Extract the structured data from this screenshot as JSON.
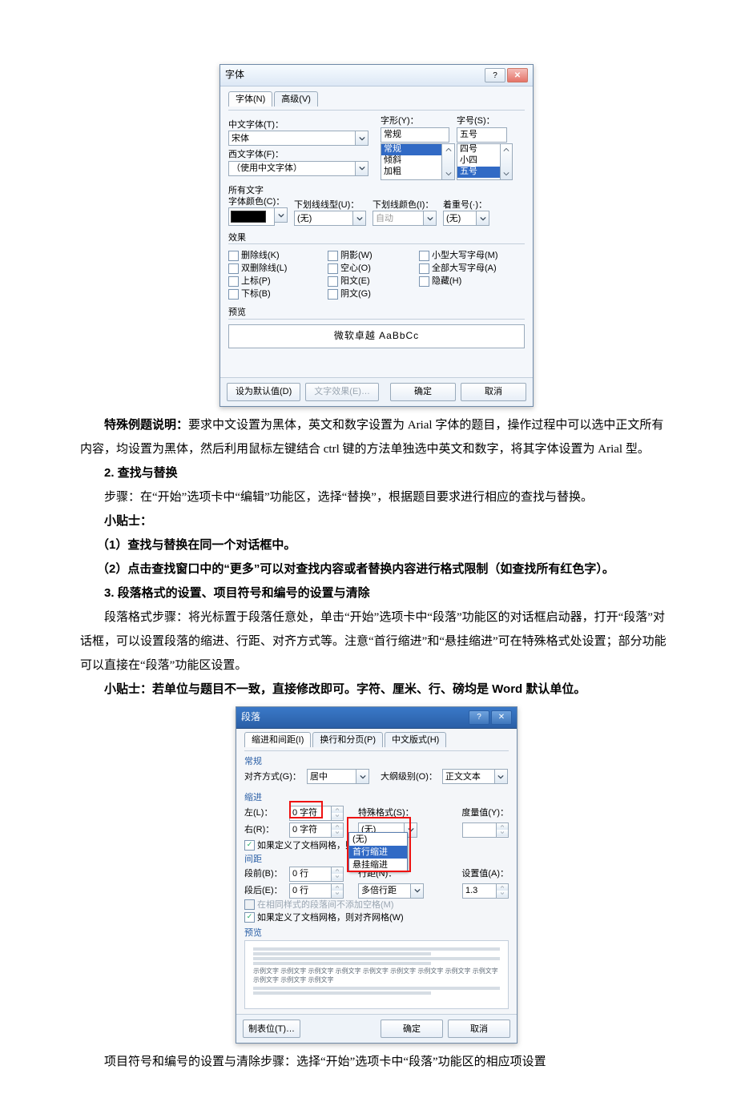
{
  "font_dialog": {
    "title": "字体",
    "help_icon": "help-icon",
    "close_icon": "close-icon",
    "tabs": {
      "font": "字体(N)",
      "advanced": "高级(V)"
    },
    "labels": {
      "cn_font": "中文字体(T)：",
      "west_font": "西文字体(F)：",
      "style": "字形(Y)：",
      "size": "字号(S)：",
      "all_text": "所有文字",
      "font_color": "字体颜色(C)：",
      "underline": "下划线线型(U)：",
      "underline_color": "下划线颜色(I)：",
      "emphasis": "着重号(·)：",
      "effects": "效果",
      "preview": "预览"
    },
    "values": {
      "cn_font": "宋体",
      "west_font": "（使用中文字体）",
      "style_input": "常规",
      "style_options": [
        "常规",
        "倾斜",
        "加粗"
      ],
      "style_selected_index": 0,
      "size_input": "五号",
      "size_options": [
        "四号",
        "小四",
        "五号"
      ],
      "size_selected_index": 2,
      "underline": "(无)",
      "underline_color": "自动",
      "emphasis": "(无)"
    },
    "effects_col1": [
      "删除线(K)",
      "双删除线(L)",
      "上标(P)",
      "下标(B)"
    ],
    "effects_col2": [
      "阴影(W)",
      "空心(O)",
      "阳文(E)",
      "阴文(G)"
    ],
    "effects_col3": [
      "小型大写字母(M)",
      "全部大写字母(A)",
      "隐藏(H)"
    ],
    "preview_text": "微软卓越  AaBbCc",
    "footer": {
      "default": "设为默认值(D)",
      "text_effects": "文字效果(E)…",
      "ok": "确定",
      "cancel": "取消"
    }
  },
  "doc": {
    "p1_label": "特殊例题说明：",
    "p1_text": "要求中文设置为黑体，英文和数字设置为 Arial 字体的题目，操作过程中可以选中正文所有内容，均设置为黑体，然后利用鼠标左键结合 ctrl 键的方法单独选中英文和数字，将其字体设置为 Arial 型。",
    "h2": "2. 查找与替换",
    "p2": "步骤：在“开始”选项卡中“编辑”功能区，选择“替换”，根据题目要求进行相应的查找与替换。",
    "tip_label": "小贴士：",
    "tip1": "（1）查找与替换在同一个对话框中。",
    "tip2": "（2）点击查找窗口中的“更多”可以对查找内容或者替换内容进行格式限制（如查找所有红色字）。",
    "h3": "3. 段落格式的设置、项目符号和编号的设置与清除",
    "p3": "段落格式步骤：将光标置于段落任意处，单击“开始”选项卡中“段落”功能区的对话框启动器，打开“段落”对话框，可以设置段落的缩进、行距、对齐方式等。注意“首行缩进”和“悬挂缩进”可在特殊格式处设置；部分功能可以直接在“段落”功能区设置。",
    "tip3": "小贴士：若单位与题目不一致，直接修改即可。字符、厘米、行、磅均是 Word 默认单位。",
    "p_last": "项目符号和编号的设置与清除步骤：选择“开始”选项卡中“段落”功能区的相应项设置"
  },
  "para_dialog": {
    "title": "段落",
    "tabs": [
      "缩进和间距(I)",
      "换行和分页(P)",
      "中文版式(H)"
    ],
    "sect_general": "常规",
    "align_label": "对齐方式(G)：",
    "align_value": "居中",
    "outline_label": "大纲级别(O)：",
    "outline_value": "正文文本",
    "sect_indent": "缩进",
    "left_label": "左(L)：",
    "left_value": "0 字符",
    "right_label": "右(R)：",
    "right_value": "0 字符",
    "special_label": "特殊格式(S)：",
    "special_value": "(无)",
    "special_options": [
      "(无)",
      "首行缩进",
      "悬挂缩进"
    ],
    "metric_label": "度量值(Y)：",
    "metric_value": "",
    "chk_grid_indent": "如果定义了文档网格，则自动调",
    "sect_spacing": "间距",
    "before_label": "段前(B)：",
    "before_value": "0 行",
    "after_label": "段后(E)：",
    "after_value": "0 行",
    "linespace_label": "行距(N)：",
    "linespace_value": "多倍行距",
    "setvalue_label": "设置值(A)：",
    "setvalue_value": "1.3",
    "chk_no_space": "在相同样式的段落间不添加空格(M)",
    "chk_grid_space": "如果定义了文档网格，则对齐网格(W)",
    "sect_preview": "预览",
    "preview_line": "示例文字 示例文字 示例文字 示例文字 示例文字 示例文字 示例文字 示例文字 示例文字 示例文字 示例文字 示例文字",
    "footer": {
      "tabs": "制表位(T)…",
      "ok": "确定",
      "cancel": "取消"
    }
  }
}
